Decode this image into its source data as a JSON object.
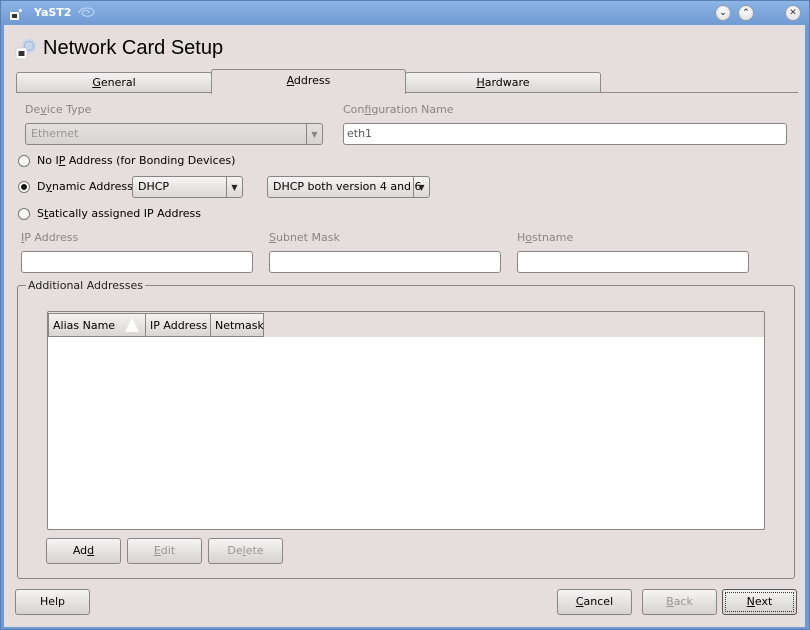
{
  "window": {
    "title": "YaST2",
    "controls": [
      "minimize",
      "maximize",
      "close"
    ]
  },
  "heading": {
    "title": "Network Card Setup",
    "icon": "network-card-icon"
  },
  "tabs": [
    {
      "label_pre": "",
      "mnemonic": "G",
      "label_post": "eneral",
      "active": false
    },
    {
      "label_pre": "",
      "mnemonic": "A",
      "label_post": "ddress",
      "active": true
    },
    {
      "label_pre": "",
      "mnemonic": "H",
      "label_post": "ardware",
      "active": false
    }
  ],
  "device_type": {
    "label_pre": "De",
    "mnemonic": "v",
    "label_post": "ice Type",
    "value": "Ethernet",
    "enabled": false
  },
  "configuration_name": {
    "label_pre": "Con",
    "mnemonic": "f",
    "label_post": "iguration Name",
    "value": "eth1"
  },
  "address_mode": {
    "options": [
      {
        "label_pre": "No I",
        "mnemonic": "P",
        "label_post": " Address (for Bonding Devices)",
        "checked": false
      },
      {
        "label_pre": "D",
        "mnemonic": "y",
        "label_post": "namic Address",
        "checked": true
      },
      {
        "label_pre": "S",
        "mnemonic": "t",
        "label_post": "atically assigned IP Address",
        "checked": false
      }
    ],
    "dynamic_method": "DHCP",
    "dhcp_version": "DHCP both version 4 and 6"
  },
  "static": {
    "ip_address": {
      "label_pre": "",
      "mnemonic": "I",
      "label_post": "P Address",
      "value": ""
    },
    "subnet_mask": {
      "label_pre": "",
      "mnemonic": "S",
      "label_post": "ubnet Mask",
      "value": ""
    },
    "hostname": {
      "label_pre": "H",
      "mnemonic": "o",
      "label_post": "stname",
      "value": ""
    }
  },
  "additional_addresses": {
    "title": "Additional Addresses",
    "columns": [
      "Alias Name",
      "IP Address",
      "Netmask"
    ],
    "sort_column": "Alias Name",
    "rows": [],
    "buttons": {
      "add": {
        "label_pre": "Ad",
        "mnemonic": "d",
        "label_post": "",
        "enabled": true
      },
      "edit": {
        "label_pre": "",
        "mnemonic": "E",
        "label_post": "dit",
        "enabled": false
      },
      "delete": {
        "label_pre": "De",
        "mnemonic": "l",
        "label_post": "ete",
        "enabled": false
      }
    }
  },
  "footer": {
    "help": {
      "label": "Help"
    },
    "cancel": {
      "label_pre": "",
      "mnemonic": "C",
      "label_post": "ancel",
      "enabled": true
    },
    "back": {
      "label_pre": "",
      "mnemonic": "B",
      "label_post": "ack",
      "enabled": false
    },
    "next": {
      "label_pre": "",
      "mnemonic": "N",
      "label_post": "ext",
      "enabled": true,
      "focused": true
    }
  }
}
